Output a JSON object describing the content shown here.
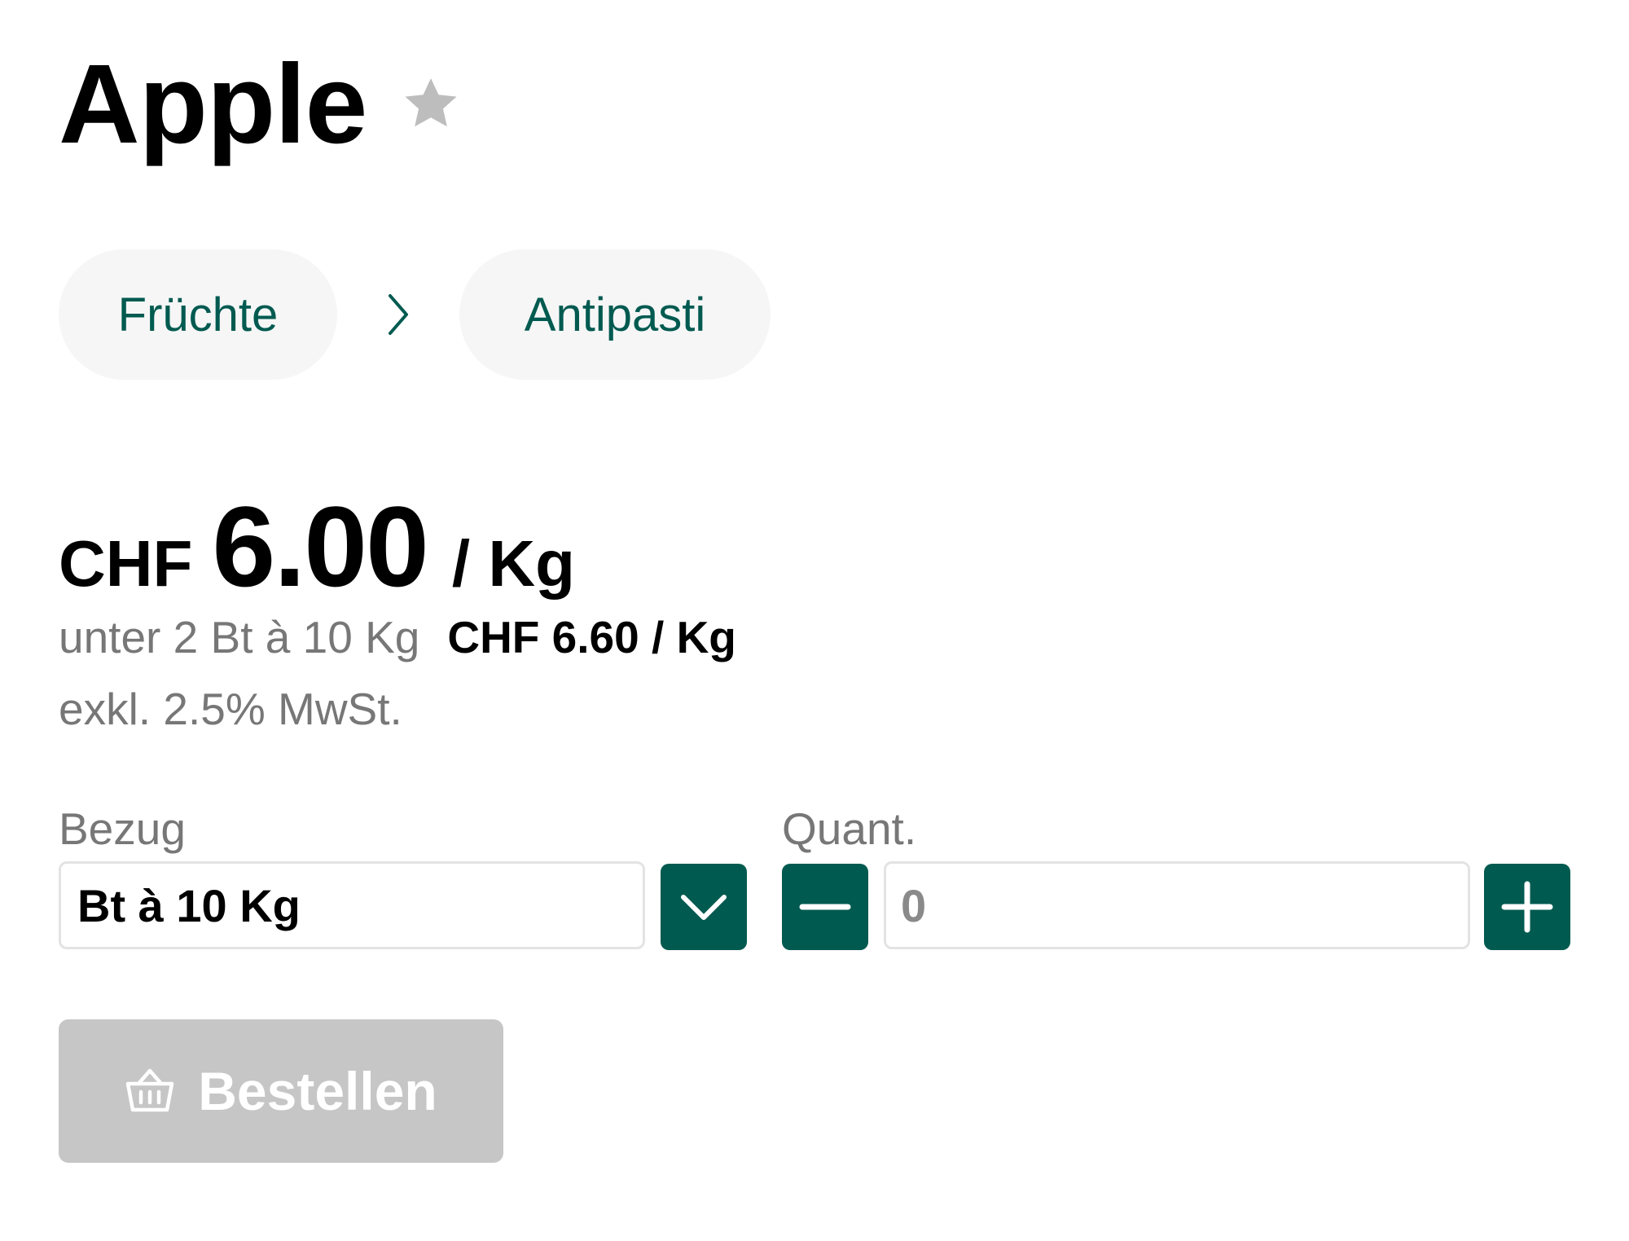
{
  "product": {
    "title": "Apple",
    "favorite_icon": "star-icon"
  },
  "breadcrumb": {
    "items": [
      {
        "label": "Früchte"
      },
      {
        "label": "Antipasti"
      }
    ],
    "separator_icon": "chevron-right-icon"
  },
  "price": {
    "currency": "CHF",
    "amount": "6.00",
    "unit": "/ Kg",
    "tier_label": "unter 2 Bt à 10 Kg",
    "tier_price": "CHF 6.60 / Kg",
    "vat_note": "exkl. 2.5% MwSt."
  },
  "order_form": {
    "bezug_label": "Bezug",
    "bezug_value": "Bt à 10 Kg",
    "dropdown_icon": "chevron-down-icon",
    "quant_label": "Quant.",
    "quant_value": "0",
    "minus_icon": "minus-icon",
    "plus_icon": "plus-icon",
    "order_button_label": "Bestellen",
    "order_button_icon": "basket-icon"
  },
  "colors": {
    "brand": "#005a50",
    "muted_text": "#777777",
    "chip_background": "#f6f6f6",
    "disabled_button": "#c6c6c6",
    "favorite_star": "#bdbdbd"
  }
}
